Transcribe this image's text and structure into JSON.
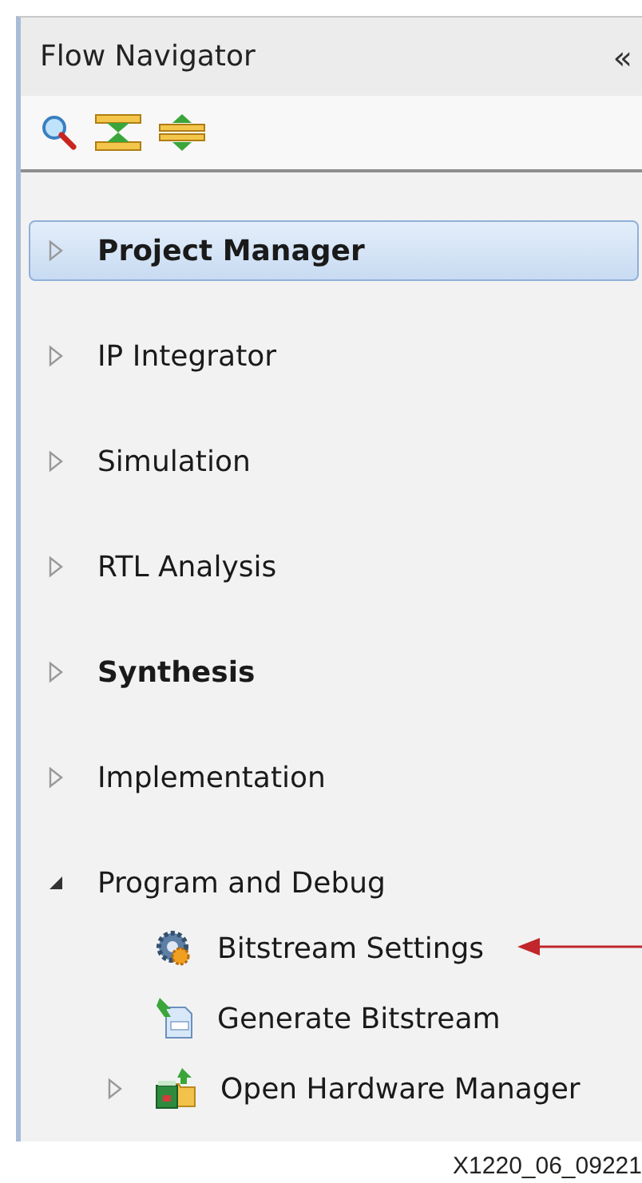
{
  "panel": {
    "title": "Flow Navigator",
    "collapse_button": "«"
  },
  "toolbar": [
    {
      "kind": "search"
    },
    {
      "kind": "expand"
    },
    {
      "kind": "collapse"
    }
  ],
  "sections": [
    {
      "label": "Project Manager",
      "bold": true,
      "selected": true,
      "expanded": false
    },
    {
      "label": "IP Integrator",
      "bold": false,
      "selected": false,
      "expanded": false
    },
    {
      "label": "Simulation",
      "bold": false,
      "selected": false,
      "expanded": false
    },
    {
      "label": "RTL Analysis",
      "bold": false,
      "selected": false,
      "expanded": false
    },
    {
      "label": "Synthesis",
      "bold": true,
      "selected": false,
      "expanded": false
    },
    {
      "label": "Implementation",
      "bold": false,
      "selected": false,
      "expanded": false
    },
    {
      "label": "Program and Debug",
      "bold": false,
      "selected": false,
      "expanded": true,
      "children": [
        {
          "label": "Bitstream Settings",
          "kind": "settings",
          "callout": {
            "kind": "arrow"
          }
        },
        {
          "label": "Generate Bitstream",
          "kind": "generate"
        },
        {
          "label": "Open Hardware Manager",
          "kind": "hardware",
          "expanded": false
        }
      ]
    }
  ],
  "figure_label": "X1220_06_09221"
}
